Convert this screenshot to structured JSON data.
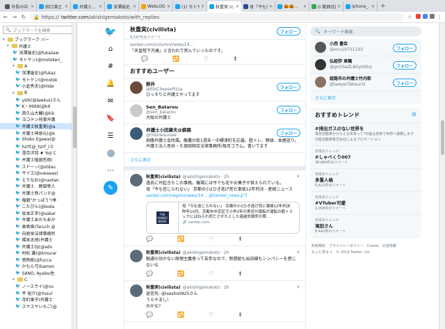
{
  "tabs": [
    {
      "title": "市長の中…",
      "color": "#555555",
      "active": false
    },
    {
      "title": "田口凛之…",
      "color": "#1da1f2",
      "active": false
    },
    {
      "title": "弁護士…",
      "color": "#1da1f2",
      "active": false
    },
    {
      "title": "深澤諭史…",
      "color": "#1da1f2",
      "active": false
    },
    {
      "title": "WebLOG…",
      "color": "#f4a300",
      "active": false
    },
    {
      "title": "(1) モトヤ…",
      "color": "#1da1f2",
      "active": false
    },
    {
      "title": "秋重実 (c…",
      "color": "#1da1f2",
      "active": true
    },
    {
      "title": "母「今も信…",
      "color": "#2b4a8b",
      "active": false
    },
    {
      "title": "🎃🎃…",
      "color": "#1da1f2",
      "active": false
    },
    {
      "title": "G 範囲北部…",
      "color": "#34a853",
      "active": false
    },
    {
      "title": "iphone_…",
      "color": "#1da1f2",
      "active": false
    }
  ],
  "newtab": "+",
  "address": {
    "scheme": "https://",
    "domain": "twitter.com",
    "path": "/akishigemakoto/with_replies"
  },
  "bookmarks": {
    "search_placeholder": "ブックマークを検索",
    "items": [
      {
        "label": "ブックマーク バー",
        "type": "folder",
        "indent": 0
      },
      {
        "label": "弁護士",
        "type": "folder",
        "indent": 1
      },
      {
        "label": "深澤諭史(@fukazaw",
        "type": "bird",
        "indent": 2
      },
      {
        "label": "モトヤン(@motoken_",
        "type": "bird",
        "indent": 2
      },
      {
        "label": "A",
        "type": "folder",
        "indent": 2
      },
      {
        "label": "深澤諭史(@fukaz",
        "type": "bird",
        "indent": 3
      },
      {
        "label": "モトケン(@motok",
        "type": "bird",
        "indent": 3
      },
      {
        "label": "小倉秀夫(@Hide",
        "type": "bird",
        "indent": 3
      },
      {
        "label": "B",
        "type": "folder",
        "indent": 2
      },
      {
        "label": "ystk(@lawkus)さん",
        "type": "bird",
        "indent": 3
      },
      {
        "label": "K・9999(@k9",
        "type": "bird",
        "indent": 3
      },
      {
        "label": "首久山大輔(@kik",
        "type": "bird",
        "indent": 3
      },
      {
        "label": "ヨコテン刑事弁護",
        "type": "bird",
        "indent": 3
      },
      {
        "label": "弁護士秋重実(@a",
        "type": "bird",
        "indent": 3,
        "selected": true
      },
      {
        "label": "弁護士神原元(@k",
        "type": "bird",
        "indent": 3
      },
      {
        "label": "Shoko Egawa(@",
        "type": "bird",
        "indent": 3
      },
      {
        "label": "hzrf(@_hzrf_)さ",
        "type": "bird",
        "indent": 3
      },
      {
        "label": "澄合洋羽 ♦ Yoji C",
        "type": "bird",
        "indent": 3
      },
      {
        "label": "弁護士植田哲郎(",
        "type": "bird",
        "indent": 3
      },
      {
        "label": "スドー☆(@stdau",
        "type": "bird",
        "indent": 3
      },
      {
        "label": "サイエ(@uwaaaa)",
        "type": "bird",
        "indent": 3
      },
      {
        "label": "とりなお(@naotan",
        "type": "bird",
        "indent": 3
      },
      {
        "label": "弁護士　野田隼人",
        "type": "bird",
        "indent": 3
      },
      {
        "label": "弁護士熊パンチ@",
        "type": "bird",
        "indent": 3
      },
      {
        "label": "俺朝\"かっぽう\"(季",
        "type": "bird",
        "indent": 3
      },
      {
        "label": "こたぴん(@koda",
        "type": "bird",
        "indent": 3
      },
      {
        "label": "坂本正幸(@sakar",
        "type": "bird",
        "indent": 3
      },
      {
        "label": "弁護士あだちあか",
        "type": "bird",
        "indent": 3
      },
      {
        "label": "高島章(Taruch @",
        "type": "bird",
        "indent": 3
      },
      {
        "label": "向原栄法律事務所",
        "type": "bird",
        "indent": 3
      },
      {
        "label": "橋本太地(弁護士",
        "type": "bird",
        "indent": 3
      },
      {
        "label": "弁護士DJ(@adv",
        "type": "bird",
        "indent": 3
      },
      {
        "label": "村松 謙(@kmurar",
        "type": "bird",
        "indent": 3
      },
      {
        "label": "感熱紙(@fucca",
        "type": "bird",
        "indent": 3
      },
      {
        "label": "かもん弓(kamon",
        "type": "bird",
        "indent": 3
      },
      {
        "label": "SANO, Ayako/佐",
        "type": "bird",
        "indent": 3
      },
      {
        "label": "C",
        "type": "folder",
        "indent": 2
      },
      {
        "label": "ノースライ(@no",
        "type": "bird",
        "indent": 3
      },
      {
        "label": "平 裕介(@Yusul",
        "type": "bird",
        "indent": 3
      },
      {
        "label": "寺町東子(弁護士",
        "type": "bird",
        "indent": 3
      },
      {
        "label": "スヤスヤいちご(@",
        "type": "bird",
        "indent": 3
      }
    ]
  },
  "timeline": {
    "header_name": "秋重実(civilista)",
    "header_count": "6,197件のツイート",
    "follow": "フォロー",
    "quote_top": "sankei.com/column/news/19…",
    "quote_text": "「天皇陛下万歳」と言われて死んでいったのです。",
    "reco_title": "おすすめユーザー",
    "users": [
      {
        "name": "餅井",
        "handle": "@EbiCheesePizza",
        "bio": "ひっそりと弁護士やってます",
        "color": "#6b4b3a"
      },
      {
        "name": "Sen_Batarou",
        "handle": "@sen_batarou",
        "bio": "大阪の弁護士",
        "color": "#c9c9c9"
      },
      {
        "name": "弁護士小田康夫@釧路",
        "handle": "@OdaYasuoaw",
        "bio": "釧路弁護士会所属。酪農の街1週末・中標津町を応援。脂トレ、野球、本屋巡り。弁護士法人思井・久保田相合法律事務所/毎月コラム。書いてます",
        "color": "#3b5b7a"
      }
    ],
    "show_more": "さらに表示",
    "tweets": [
      {
        "name": "秋重実(civilista)",
        "handle": "@akishigemakoto · 2h",
        "line1": "過去に弁起きたこの事務。機場には今でも花やお菓子が供えられている。",
        "line2": "母「今も信じられない」 京都の小2ひき逃げ死亡事故12年判決 - 産経ニュース",
        "link": "sankei.com/region/news/14… @Sankei_newsより",
        "card_title": "母「今も信じられない」 京都の小2ひき逃げ死に事故12年判決",
        "card_body": "昨年10月、京都市中京区で小学2年の男児が運転が運転の軽トラックにはねられ死亡させたとした過過失致死の罪…",
        "card_domain": "🔗 sankei.com",
        "logo": "THE SANKEI NEWS",
        "color": "#5a6b7a"
      },
      {
        "name": "秋重実(civilista)",
        "handle": "@akishigemakoto · 2h",
        "line1": "融通の効かない原理主義者って苦手なので、新撰組も出自線もシンパシーを感じないな",
        "color": "#5a6b7a"
      },
      {
        "name": "秋重実(civilista)",
        "handle": "@akishigemakoto · 2h",
        "line1": "返信先: @isesho0825さん",
        "line2": "うらやまし!",
        "line3": "のかな?",
        "color": "#5a6b7a"
      }
    ],
    "actions": [
      "💬",
      "🔁",
      "♡",
      "⬆"
    ]
  },
  "right": {
    "search_placeholder": "キーワード検索",
    "who": [
      {
        "name": "小西 豊臣",
        "handle": "@enu19721193",
        "color": "#555555"
      },
      {
        "name": "弘姫弥 東鶴",
        "handle": "@gnOSaZLBGyht6vJ",
        "color": "#333333"
      },
      {
        "name": "姫路市の弁護士竹内彰",
        "handle": "@lawyerTakeuchi",
        "color": "#8a7060"
      }
    ],
    "show_more": "さらに表示",
    "trends_title": "おすすめトレンド",
    "trends": [
      {
        "ctx": "",
        "name": "#排出ガスのない世界を",
        "desc": "電気自動車がかなえる未来って?日産は技術で世界へ挑戦します",
        "promo": "日産自動車株式会社によるプロモーション"
      },
      {
        "ctx": "日本のトレンド",
        "name": "#しゃべくり007",
        "desc": "38,884件のツイート"
      },
      {
        "ctx": "日本のトレンド",
        "name": "多重人格",
        "desc": "5,612件のツイート"
      },
      {
        "ctx": "日本のトレンド",
        "name": "#VTuber可愛",
        "desc": "2,058件のツイート"
      },
      {
        "ctx": "日本のトレンド",
        "name": "滝田さん",
        "desc": "8,442件のツイート"
      }
    ],
    "footer1": "利用規約　プライバシーポリシー　Cookie　広告情報",
    "footer2": "もっと見る ∨　© 2019 Twitter, Inc."
  }
}
